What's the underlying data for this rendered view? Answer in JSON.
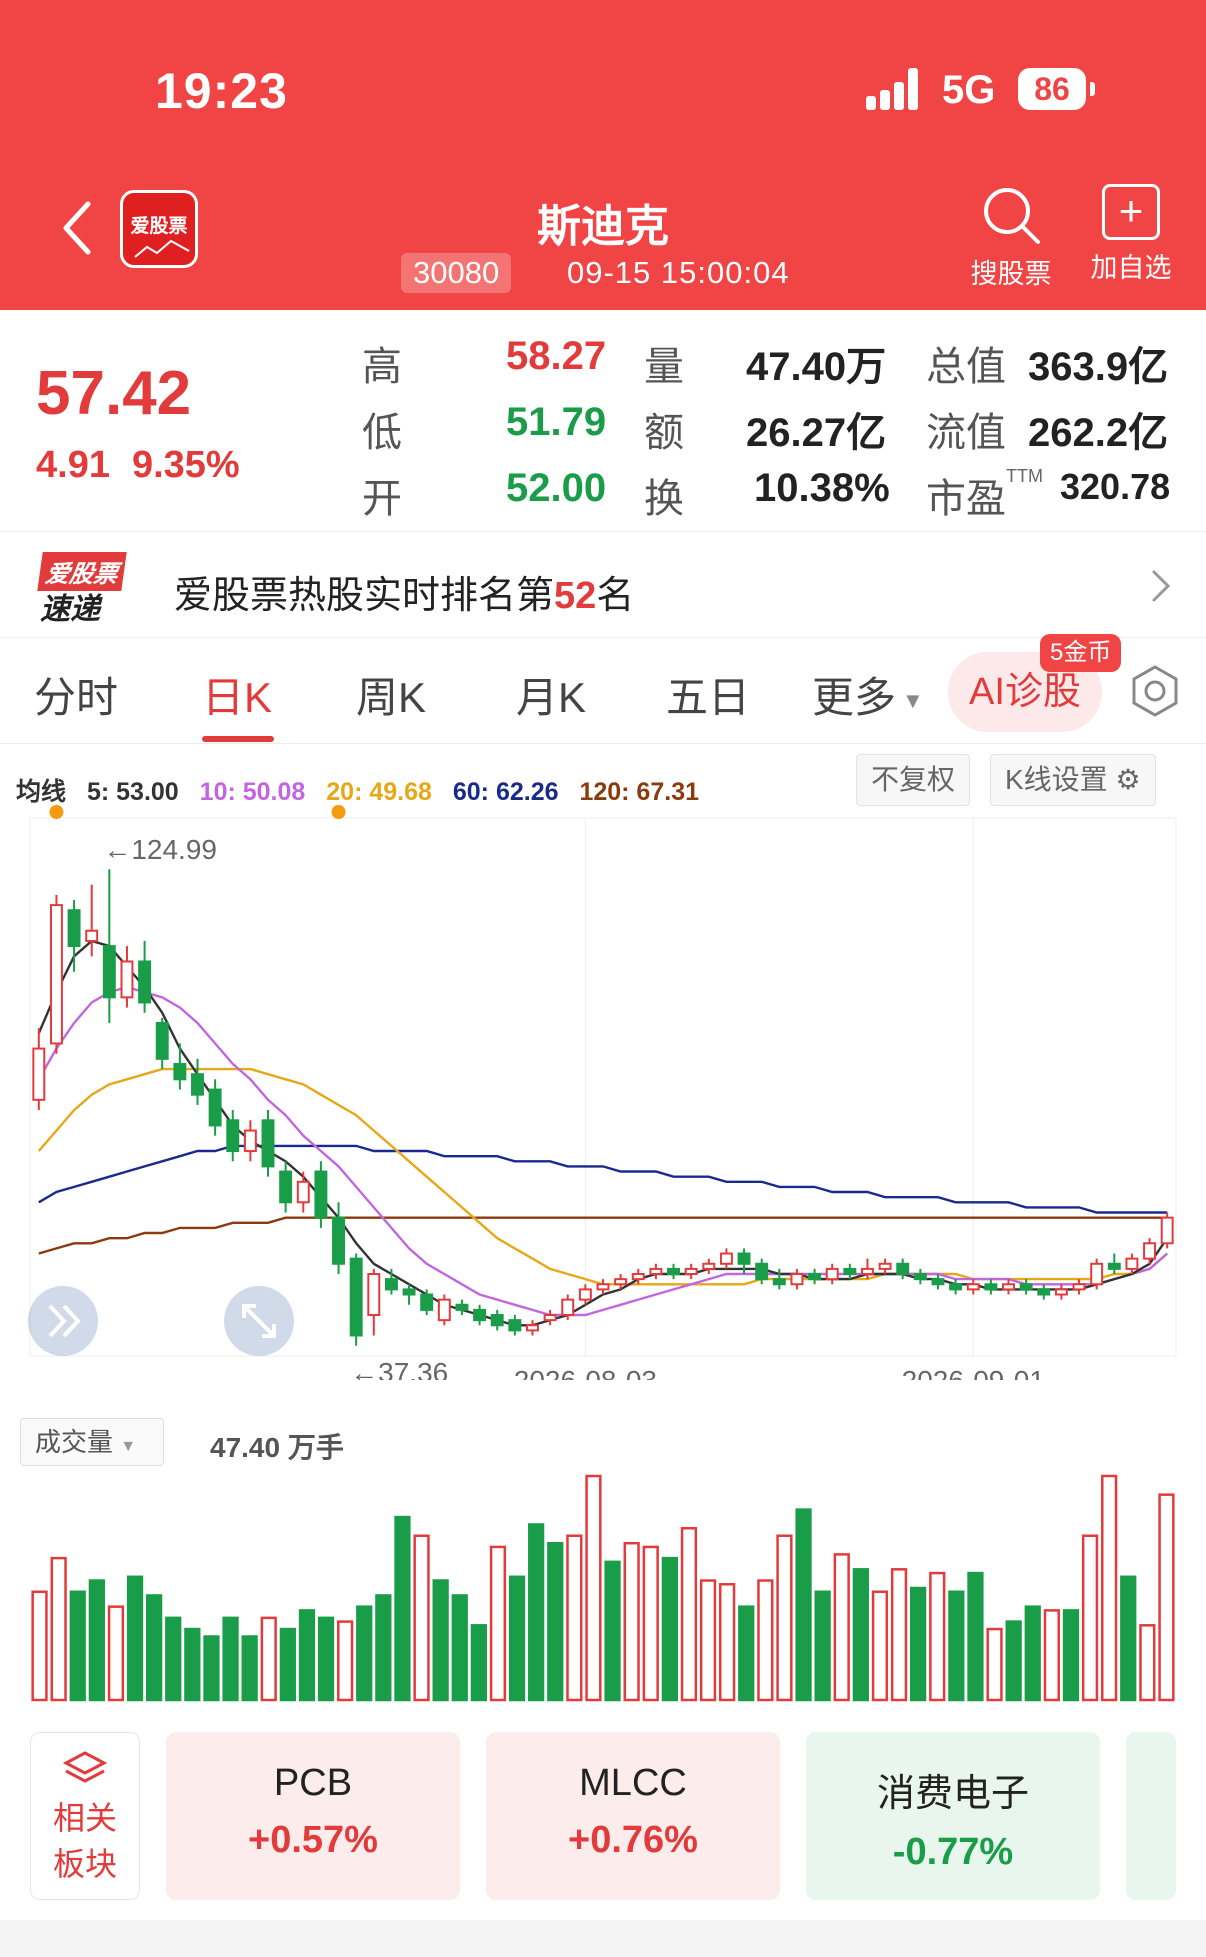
{
  "status": {
    "time": "19:23",
    "network": "5G",
    "battery": "86"
  },
  "header": {
    "logo_text": "爱股票",
    "stock_name": "斯迪克",
    "stock_code": "30080",
    "datetime": "09-15 15:00:04",
    "search_label": "搜股票",
    "add_label": "加自选"
  },
  "quote": {
    "price": "57.42",
    "change": "4.91",
    "change_pct": "9.35%",
    "rows": [
      {
        "l1": "高",
        "v1": "58.27",
        "l2": "量",
        "v2": "47.40万",
        "l3": "总值",
        "v3": "363.9亿"
      },
      {
        "l1": "低",
        "v1": "51.79",
        "l2": "额",
        "v2": "26.27亿",
        "l3": "流值",
        "v3": "262.2亿"
      },
      {
        "l1": "开",
        "v1": "52.00",
        "l2": "换",
        "v2": "10.38%",
        "l3": "市盈",
        "v3": "320.78"
      }
    ],
    "ttm": "TTM"
  },
  "rank": {
    "logo_line1": "爱股票",
    "logo_line2": "速递",
    "text_prefix": "爱股票热股实时排名第",
    "rank_number": "52",
    "text_suffix": "名"
  },
  "tabs": {
    "items": [
      "分时",
      "日K",
      "周K",
      "月K",
      "五日",
      "更多"
    ],
    "active": "日K",
    "ai_label": "AI诊股",
    "ai_badge": "5金币"
  },
  "ma": {
    "label": "均线",
    "items": [
      {
        "text": "5: 53.00",
        "color": "#333333"
      },
      {
        "text": "10: 50.08",
        "color": "#c266e0"
      },
      {
        "text": "20: 49.68",
        "color": "#e6a817"
      },
      {
        "text": "60: 62.26",
        "color": "#1a2a8c"
      },
      {
        "text": "120: 67.31",
        "color": "#8b3a0e"
      }
    ],
    "fq_label": "不复权",
    "kset_label": "K线设置"
  },
  "chart_data": {
    "type": "candlestick",
    "x_ticks": [
      "2026-08-03",
      "2026-09-01"
    ],
    "high_label": "←124.99",
    "low_label": "←37.36",
    "ylim": [
      30,
      135
    ],
    "colors": {
      "up": "#e23b3b",
      "down": "#1a9d48"
    },
    "candles": [
      [
        80,
        90,
        78,
        94
      ],
      [
        91,
        118,
        89,
        120
      ],
      [
        117,
        110,
        105,
        119
      ],
      [
        111,
        113,
        108,
        122
      ],
      [
        110,
        100,
        95,
        125
      ],
      [
        100,
        107,
        98,
        110
      ],
      [
        107,
        99,
        97,
        111
      ],
      [
        95,
        88,
        86,
        96
      ],
      [
        87,
        84,
        82,
        91
      ],
      [
        85,
        81,
        79,
        88
      ],
      [
        82,
        75,
        73,
        84
      ],
      [
        76,
        70,
        68,
        78
      ],
      [
        70,
        74,
        68,
        76
      ],
      [
        76,
        67,
        65,
        78
      ],
      [
        66,
        60,
        58,
        68
      ],
      [
        60,
        64,
        58,
        66
      ],
      [
        66,
        57,
        55,
        68
      ],
      [
        57,
        48,
        46,
        60
      ],
      [
        49,
        34,
        32,
        50
      ],
      [
        38,
        46,
        34,
        47
      ],
      [
        45,
        43,
        42,
        47
      ],
      [
        43,
        42,
        40,
        44
      ],
      [
        42,
        39,
        38,
        43
      ],
      [
        37,
        41,
        36,
        42
      ],
      [
        40,
        39,
        38,
        41
      ],
      [
        39,
        37,
        36,
        40
      ],
      [
        38,
        36,
        35,
        39
      ],
      [
        37,
        35,
        34,
        38
      ],
      [
        35,
        36,
        34,
        37
      ],
      [
        37,
        38,
        36,
        39
      ],
      [
        38,
        41,
        37,
        42
      ],
      [
        41,
        43,
        40,
        44
      ],
      [
        43,
        44,
        42,
        45
      ],
      [
        44,
        45,
        43,
        46
      ],
      [
        45,
        46,
        44,
        47
      ],
      [
        46,
        47,
        45,
        48
      ],
      [
        47,
        46,
        45,
        48
      ],
      [
        46,
        47,
        45,
        48
      ],
      [
        47,
        48,
        46,
        49
      ],
      [
        48,
        50,
        47,
        51
      ],
      [
        50,
        48,
        46,
        51
      ],
      [
        48,
        45,
        44,
        49
      ],
      [
        45,
        44,
        43,
        47
      ],
      [
        44,
        46,
        43,
        47
      ],
      [
        46,
        45,
        44,
        47
      ],
      [
        45,
        47,
        44,
        48
      ],
      [
        47,
        46,
        45,
        48
      ],
      [
        46,
        47,
        45,
        49
      ],
      [
        47,
        48,
        46,
        49
      ],
      [
        48,
        46,
        45,
        49
      ],
      [
        46,
        45,
        44,
        47
      ],
      [
        45,
        44,
        43,
        46
      ],
      [
        44,
        43,
        42,
        45
      ],
      [
        43,
        44,
        42,
        45
      ],
      [
        44,
        43,
        42,
        45
      ],
      [
        43,
        44,
        42,
        45
      ],
      [
        44,
        43,
        42,
        45
      ],
      [
        43,
        42,
        41,
        44
      ],
      [
        42,
        43,
        41,
        44
      ],
      [
        43,
        44,
        42,
        45
      ],
      [
        44,
        48,
        43,
        49
      ],
      [
        48,
        47,
        46,
        50
      ],
      [
        47,
        49,
        46,
        50
      ],
      [
        49,
        52,
        48,
        53
      ],
      [
        52,
        57,
        51,
        58
      ]
    ],
    "ma5": [
      93,
      101,
      108,
      111,
      110,
      106,
      102,
      97,
      90,
      85,
      80,
      75,
      72,
      70,
      68,
      65,
      61,
      57,
      52,
      48,
      46,
      44,
      42,
      40,
      39,
      38,
      37,
      36,
      36,
      37,
      38,
      40,
      42,
      43,
      45,
      46,
      46,
      46,
      47,
      47,
      47,
      47,
      46,
      46,
      45,
      45,
      45,
      46,
      46,
      46,
      45,
      45,
      44,
      44,
      43,
      43,
      43,
      43,
      43,
      43,
      44,
      45,
      46,
      48,
      53
    ],
    "ma10": [
      84,
      90,
      95,
      99,
      101,
      102,
      101,
      100,
      98,
      95,
      91,
      87,
      84,
      80,
      77,
      73,
      70,
      67,
      63,
      59,
      55,
      51,
      48,
      46,
      44,
      42,
      41,
      40,
      39,
      38,
      38,
      38,
      39,
      40,
      41,
      42,
      43,
      44,
      45,
      46,
      46,
      46,
      46,
      46,
      46,
      46,
      46,
      46,
      46,
      46,
      46,
      46,
      45,
      45,
      45,
      45,
      44,
      44,
      44,
      44,
      44,
      45,
      46,
      47,
      50
    ],
    "ma20": [
      70,
      74,
      78,
      81,
      83,
      84,
      85,
      86,
      86,
      86,
      86,
      86,
      86,
      85,
      84,
      83,
      81,
      79,
      77,
      74,
      71,
      68,
      65,
      62,
      59,
      56,
      53,
      51,
      49,
      47,
      46,
      45,
      44,
      44,
      44,
      44,
      44,
      44,
      44,
      44,
      44,
      45,
      45,
      45,
      45,
      45,
      45,
      45,
      46,
      46,
      46,
      46,
      46,
      45,
      45,
      45,
      45,
      45,
      45,
      45,
      45,
      46,
      46,
      47,
      50
    ],
    "ma60": [
      60,
      62,
      63,
      64,
      65,
      66,
      67,
      68,
      69,
      70,
      70,
      71,
      71,
      71,
      71,
      71,
      71,
      71,
      71,
      70,
      70,
      70,
      70,
      69,
      69,
      69,
      69,
      68,
      68,
      68,
      67,
      67,
      67,
      66,
      66,
      66,
      65,
      65,
      65,
      64,
      64,
      64,
      63,
      63,
      63,
      62,
      62,
      62,
      61,
      61,
      61,
      61,
      60,
      60,
      60,
      60,
      59,
      59,
      59,
      59,
      58,
      58,
      58,
      58,
      58
    ],
    "ma120": [
      50,
      51,
      52,
      52,
      53,
      53,
      54,
      54,
      55,
      55,
      55,
      56,
      56,
      56,
      57,
      57,
      57,
      57,
      57,
      57,
      57,
      57,
      57,
      57,
      57,
      57,
      57,
      57,
      57,
      57,
      57,
      57,
      57,
      57,
      57,
      57,
      57,
      57,
      57,
      57,
      57,
      57,
      57,
      57,
      57,
      57,
      57,
      57,
      57,
      57,
      57,
      57,
      57,
      57,
      57,
      57,
      57,
      57,
      57,
      57,
      57,
      57,
      57,
      57,
      57
    ],
    "volume": [
      [
        29,
        1
      ],
      [
        38,
        1
      ],
      [
        29,
        0
      ],
      [
        32,
        0
      ],
      [
        25,
        1
      ],
      [
        33,
        0
      ],
      [
        28,
        0
      ],
      [
        22,
        0
      ],
      [
        19,
        0
      ],
      [
        17,
        0
      ],
      [
        22,
        0
      ],
      [
        17,
        0
      ],
      [
        22,
        1
      ],
      [
        19,
        0
      ],
      [
        24,
        0
      ],
      [
        22,
        0
      ],
      [
        21,
        1
      ],
      [
        25,
        0
      ],
      [
        28,
        0
      ],
      [
        49,
        0
      ],
      [
        44,
        1
      ],
      [
        32,
        0
      ],
      [
        28,
        0
      ],
      [
        20,
        0
      ],
      [
        41,
        1
      ],
      [
        33,
        0
      ],
      [
        47,
        0
      ],
      [
        42,
        0
      ],
      [
        44,
        1
      ],
      [
        60,
        1
      ],
      [
        37,
        0
      ],
      [
        42,
        1
      ],
      [
        41,
        1
      ],
      [
        38,
        0
      ],
      [
        46,
        1
      ],
      [
        32,
        1
      ],
      [
        31,
        1
      ],
      [
        25,
        0
      ],
      [
        32,
        1
      ],
      [
        44,
        1
      ],
      [
        51,
        0
      ],
      [
        29,
        0
      ],
      [
        39,
        1
      ],
      [
        35,
        0
      ],
      [
        29,
        1
      ],
      [
        35,
        1
      ],
      [
        30,
        0
      ],
      [
        34,
        1
      ],
      [
        29,
        0
      ],
      [
        34,
        0
      ],
      [
        19,
        1
      ],
      [
        21,
        0
      ],
      [
        25,
        0
      ],
      [
        24,
        1
      ],
      [
        24,
        0
      ],
      [
        44,
        1
      ],
      [
        60,
        1
      ],
      [
        33,
        0
      ],
      [
        20,
        1
      ],
      [
        55,
        1
      ]
    ]
  },
  "volume": {
    "selector_label": "成交量",
    "value_label": "47.40 万手"
  },
  "sectors": {
    "head_label_1": "相关",
    "head_label_2": "板块",
    "items": [
      {
        "name": "PCB",
        "pct": "+0.57%",
        "dir": "up"
      },
      {
        "name": "MLCC",
        "pct": "+0.76%",
        "dir": "up"
      },
      {
        "name": "消费电子",
        "pct": "-0.77%",
        "dir": "down"
      }
    ]
  }
}
